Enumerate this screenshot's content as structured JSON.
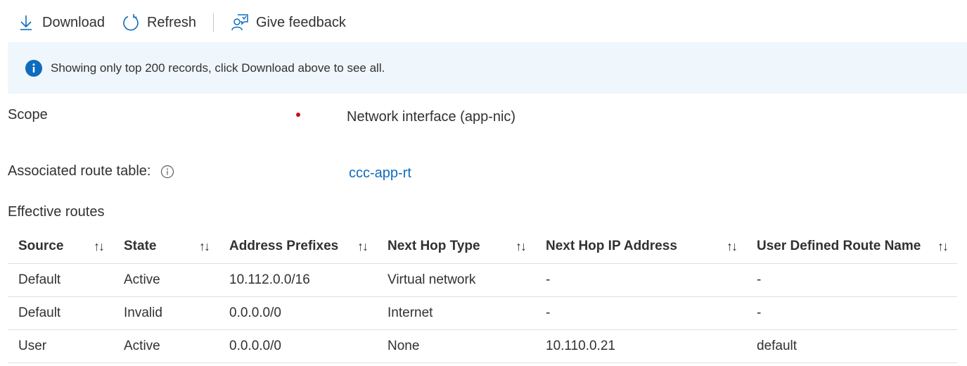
{
  "toolbar": {
    "download": "Download",
    "refresh": "Refresh",
    "feedback": "Give feedback"
  },
  "banner": {
    "message": "Showing only top 200 records, click Download above to see all."
  },
  "scope": {
    "label": "Scope",
    "value": "Network interface (app-nic)"
  },
  "route_table": {
    "label": "Associated route table:",
    "value": "ccc-app-rt"
  },
  "section_title": "Effective routes",
  "table": {
    "columns": [
      "Source",
      "State",
      "Address Prefixes",
      "Next Hop Type",
      "Next Hop IP Address",
      "User Defined Route Name"
    ],
    "sort_glyph": "↑↓",
    "rows": [
      [
        "Default",
        "Active",
        "10.112.0.0/16",
        "Virtual network",
        "-",
        "-"
      ],
      [
        "Default",
        "Invalid",
        "0.0.0.0/0",
        "Internet",
        "-",
        "-"
      ],
      [
        "User",
        "Active",
        "0.0.0.0/0",
        "None",
        "10.110.0.21",
        "default"
      ]
    ]
  },
  "colors": {
    "accent": "#0f6cbd",
    "banner_bg": "#eff6fc",
    "required": "#c50f1f"
  }
}
